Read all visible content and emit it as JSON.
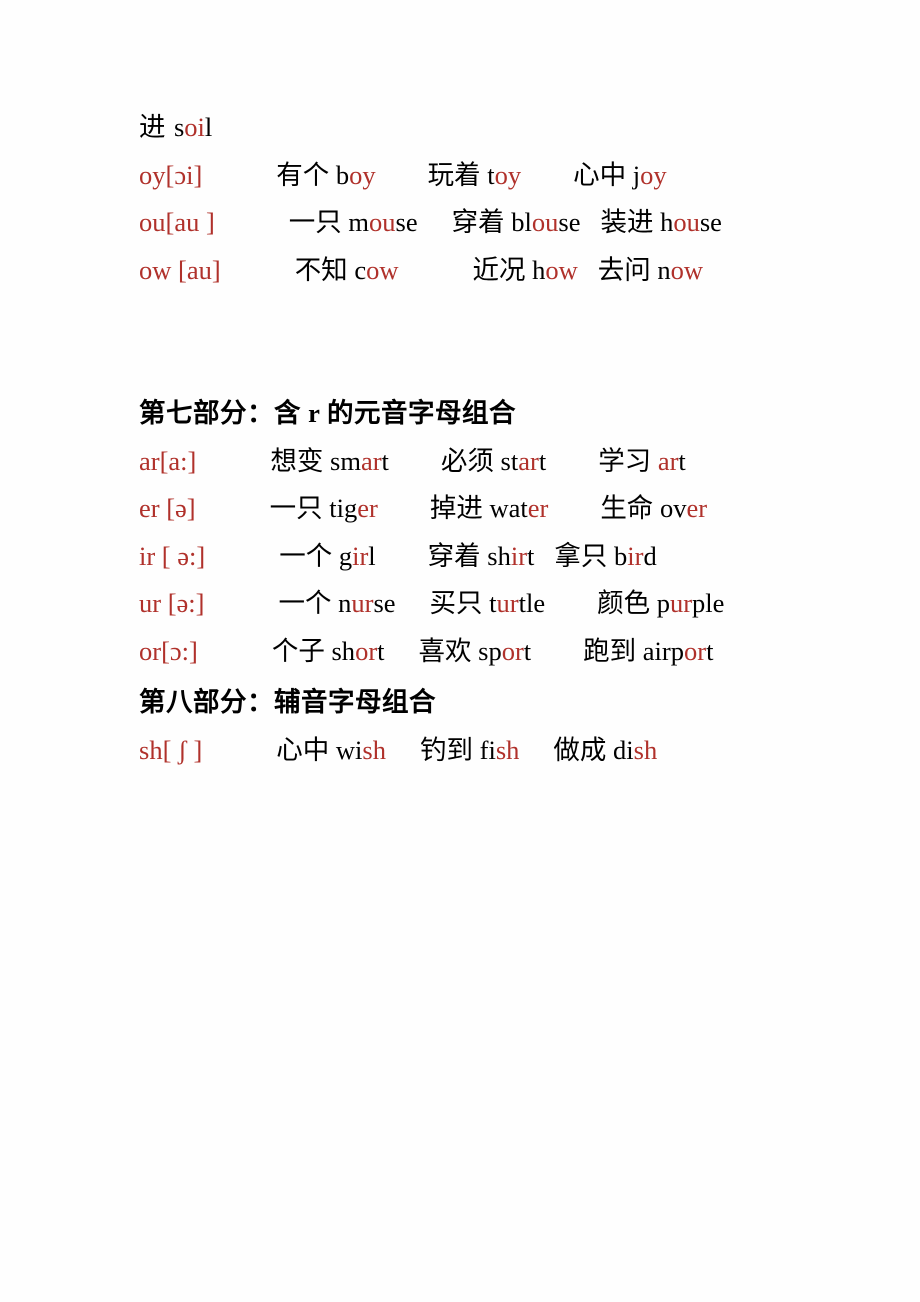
{
  "document": {
    "page_background": "#ffffff",
    "text_color": "#000000",
    "accent_color": "#b0312b",
    "language": "zh-CN + en"
  },
  "continued_entry": {
    "name": "oi-continuation",
    "prefix_cn": "进 ",
    "word": "soil",
    "word_pre": "s",
    "word_hl": "oi",
    "word_post": "l"
  },
  "sections": [
    {
      "id": "section-six-tail",
      "heading": null,
      "entries": [
        {
          "key": "oy[ɔi]",
          "examples": [
            {
              "cn": "有个",
              "pre": "b",
              "hl": "oy",
              "post": ""
            },
            {
              "cn": "玩着",
              "pre": "t",
              "hl": "oy",
              "post": ""
            },
            {
              "cn": "心中",
              "pre": "j",
              "hl": "oy",
              "post": ""
            }
          ]
        },
        {
          "key": "ou[au ]",
          "examples": [
            {
              "cn": "一只",
              "pre": "m",
              "hl": "ou",
              "post": "se"
            },
            {
              "cn": "穿着",
              "pre": "bl",
              "hl": "ou",
              "post": "se"
            },
            {
              "cn": "装进",
              "pre": "h",
              "hl": "ou",
              "post": "se"
            }
          ]
        },
        {
          "key": "ow [au]",
          "examples": [
            {
              "cn": "不知",
              "pre": "c",
              "hl": "ow",
              "post": ""
            },
            {
              "cn": "近况",
              "pre": "h",
              "hl": "ow",
              "post": ""
            },
            {
              "cn": "去问",
              "pre": "n",
              "hl": "ow",
              "post": ""
            }
          ]
        }
      ]
    },
    {
      "id": "section-seven",
      "heading": "第七部分：含 r 的元音字母组合",
      "entries": [
        {
          "key": "ar[a:]",
          "examples": [
            {
              "cn": "想变",
              "pre": "sm",
              "hl": "ar",
              "post": "t"
            },
            {
              "cn": "必须",
              "pre": "st",
              "hl": "ar",
              "post": "t"
            },
            {
              "cn": "学习",
              "pre": "",
              "hl": "ar",
              "post": "t"
            }
          ]
        },
        {
          "key": "er [ə]",
          "examples": [
            {
              "cn": "一只",
              "pre": "tig",
              "hl": "er",
              "post": ""
            },
            {
              "cn": "掉进",
              "pre": "wat",
              "hl": "er",
              "post": ""
            },
            {
              "cn": "生命",
              "pre": "ov",
              "hl": "er",
              "post": ""
            }
          ]
        },
        {
          "key": "ir [ ə:]",
          "examples": [
            {
              "cn": "一个",
              "pre": "g",
              "hl": "ir",
              "post": "l"
            },
            {
              "cn": "穿着",
              "pre": "sh",
              "hl": "ir",
              "post": "t"
            },
            {
              "cn": "拿只",
              "pre": "b",
              "hl": "ir",
              "post": "d"
            }
          ]
        },
        {
          "key": "ur [ə:]",
          "examples": [
            {
              "cn": "一个",
              "pre": "n",
              "hl": "ur",
              "post": "se"
            },
            {
              "cn": "买只",
              "pre": "t",
              "hl": "ur",
              "post": "tle"
            },
            {
              "cn": "颜色",
              "pre": "p",
              "hl": "ur",
              "post": "ple"
            }
          ]
        },
        {
          "key": "or[ɔ:]",
          "examples": [
            {
              "cn": "个子",
              "pre": "sh",
              "hl": "or",
              "post": "t"
            },
            {
              "cn": "喜欢",
              "pre": "sp",
              "hl": "or",
              "post": "t"
            },
            {
              "cn": "跑到",
              "pre": "airp",
              "hl": "or",
              "post": "t"
            }
          ]
        }
      ]
    },
    {
      "id": "section-eight",
      "heading": "第八部分：辅音字母组合",
      "entries": [
        {
          "key": "sh[ ʃ ]",
          "examples": [
            {
              "cn": "心中",
              "pre": "wi",
              "hl": "sh",
              "post": ""
            },
            {
              "cn": "钓到",
              "pre": "fi",
              "hl": "sh",
              "post": ""
            },
            {
              "cn": "做成",
              "pre": "di",
              "hl": "sh",
              "post": ""
            }
          ]
        }
      ]
    }
  ]
}
